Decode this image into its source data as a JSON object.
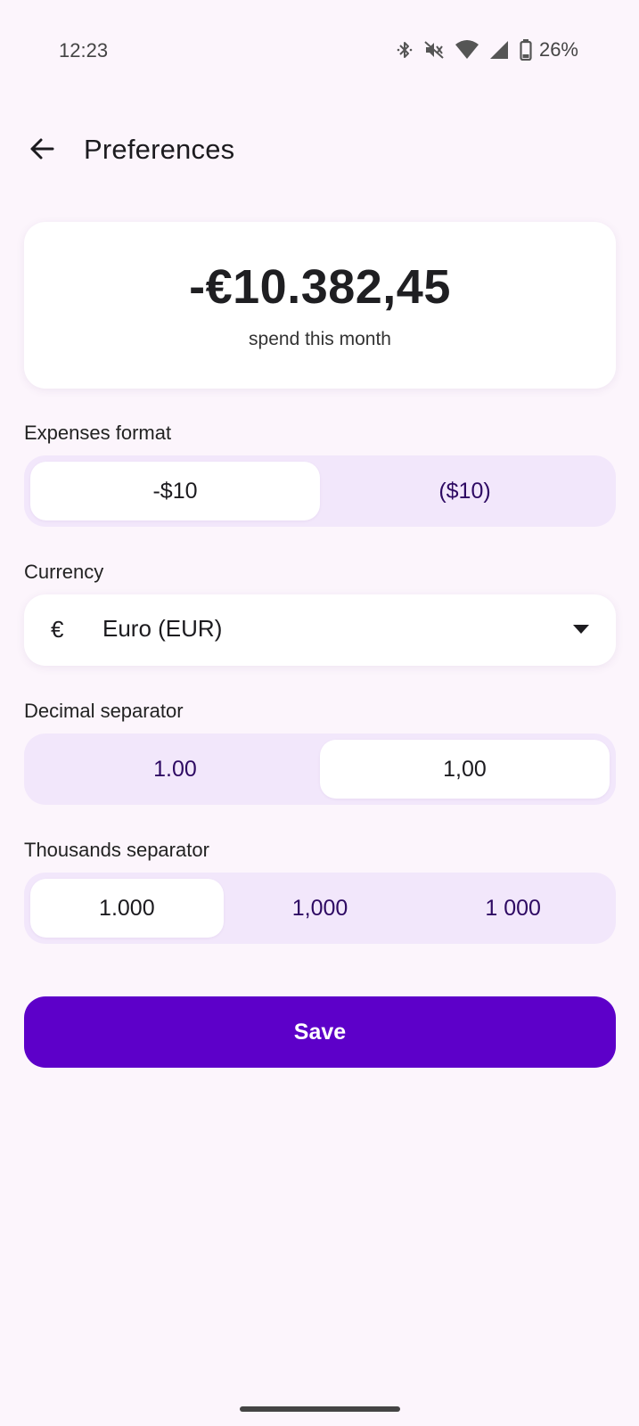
{
  "status_bar": {
    "time": "12:23",
    "battery": "26%",
    "icons": [
      "bluetooth-icon",
      "vibrate-off-icon",
      "wifi-icon",
      "cell-signal-icon",
      "battery-icon"
    ]
  },
  "app_bar": {
    "title": "Preferences",
    "back_icon": "arrow-left-icon"
  },
  "preview": {
    "amount": "-€10.382,45",
    "caption": "spend this month"
  },
  "expenses_format": {
    "label": "Expenses format",
    "options": [
      "-$10",
      "($10)"
    ],
    "selected_index": 0
  },
  "currency": {
    "label": "Currency",
    "symbol": "€",
    "value": "Euro (EUR)"
  },
  "decimal_separator": {
    "label": "Decimal separator",
    "options": [
      "1.00",
      "1,00"
    ],
    "selected_index": 1
  },
  "thousands_separator": {
    "label": "Thousands separator",
    "options": [
      "1.000",
      "1,000",
      "1 000"
    ],
    "selected_index": 0
  },
  "save_label": "Save",
  "colors": {
    "background": "#fcf5fc",
    "segment_track": "#f2e7fb",
    "primary": "#5d00c9",
    "unselected_text": "#2e0a63"
  }
}
